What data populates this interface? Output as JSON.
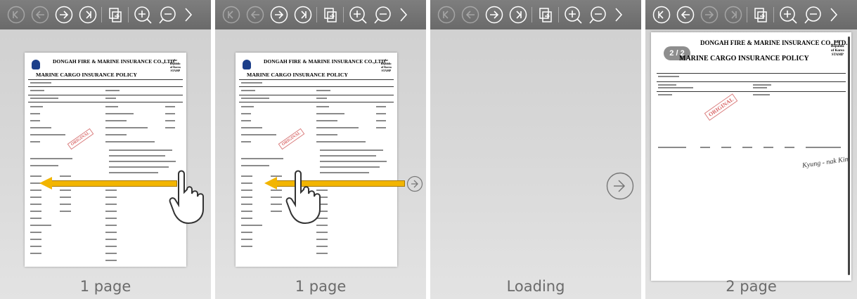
{
  "panels": [
    {
      "label": "1 page",
      "state": "swipe"
    },
    {
      "label": "1 page",
      "state": "swipe-with-next"
    },
    {
      "label": "Loading",
      "state": "loading"
    },
    {
      "label": "2 page",
      "state": "loaded"
    }
  ],
  "document": {
    "company": "DONGAH FIRE & MARINE INSURANCE CO.,LTD.",
    "policy_title": "MARINE CARGO INSURANCE POLICY",
    "stamp_text": [
      "the",
      "Republic",
      "of Korea",
      "STAMP"
    ],
    "address": "Dongdaegu, 32-7, Yeonji-Dong, Yongsanku-Gu, Seoul 134-857 Korea",
    "red_stamp": "ORIGINAL",
    "fields": [
      "Assured(s), etc",
      "Policy No.",
      "Ref. No.",
      "Claim, if any, payable at"
    ],
    "page_badge": "2 / 2",
    "place_date": "Place and Date signed in",
    "no_policies": "No. of Policies Issued",
    "signature": "Kyung - nak Kim"
  },
  "icons": {
    "toolbar": [
      "first-page-icon",
      "prev-page-icon",
      "next-page-icon",
      "last-page-icon",
      "page-view-icon",
      "zoom-in-icon",
      "zoom-out-icon",
      "more-icon"
    ]
  },
  "colors": {
    "toolbar": "#747474",
    "arrow": "#f2b500",
    "panel_bg": "#d8d8d8"
  }
}
